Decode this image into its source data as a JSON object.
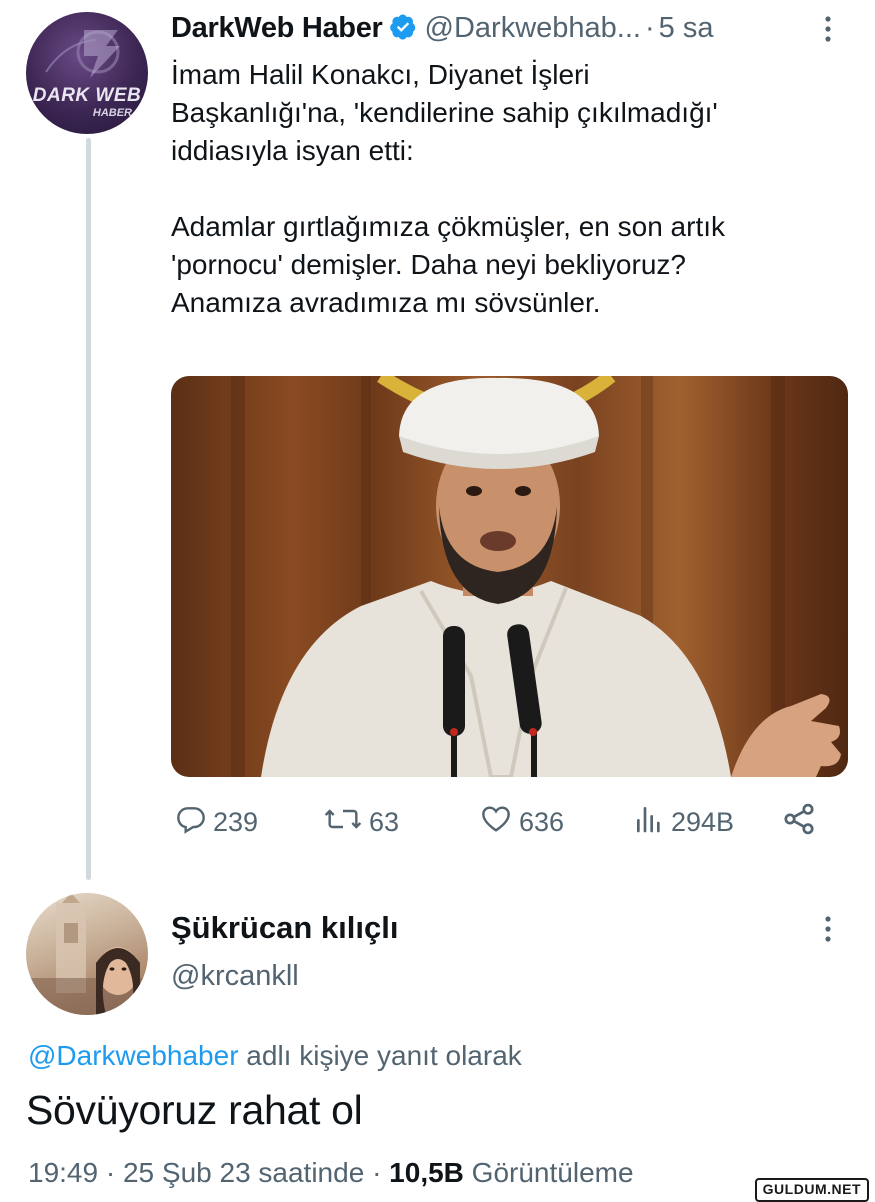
{
  "tweet": {
    "author_name": "DarkWeb Haber",
    "handle": "@Darkwebhab...",
    "separator": "·",
    "time": "5 sa",
    "avatar_text": "DARK WEB",
    "avatar_subtext": "HABER",
    "text_lines": [
      "İmam Halil Konakcı, Diyanet İşleri",
      "Başkanlığı'na, 'kendilerine sahip çıkılmadığı'",
      "iddiasıyla isyan etti:",
      "Adamlar gırtlağımıza çökmüşler, en son artık",
      "'pornocu' demişler. Daha neyi bekliyoruz?",
      "Anamıza avradımıza mı sövsünler."
    ],
    "image_icon": "photo-of-imam-speaking",
    "actions": {
      "replies": "239",
      "retweets": "63",
      "likes": "636",
      "views": "294B"
    },
    "icons": [
      "verified-icon",
      "more-icon",
      "reply-icon",
      "retweet-icon",
      "like-icon",
      "views-icon",
      "share-icon"
    ]
  },
  "reply": {
    "author_name": "Şükrücan kılıçlı",
    "handle": "@krcankll",
    "reply_mention": "@Darkwebhaber",
    "reply_suffix": " adlı kişiye yanıt olarak",
    "text": "Sövüyoruz rahat ol",
    "time": "19:49",
    "sep": "·",
    "date": "25 Şub 23 saatinde",
    "views_count": "10,5B",
    "views_label": "Görüntüleme"
  },
  "watermark": "GULDUM.NET",
  "colors": {
    "text": "#0f1419",
    "secondary": "#536471",
    "link": "#1d9bf0",
    "verified": "#1d9bf0",
    "thread_line": "#cfd9de"
  }
}
